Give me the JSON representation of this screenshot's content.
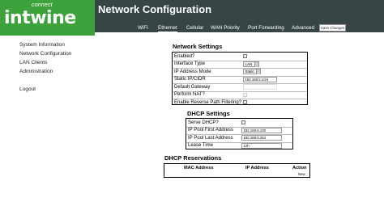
{
  "brand": {
    "tag": "connect",
    "name": "intwine",
    "color": "#3da23b"
  },
  "sidebar": {
    "items": [
      {
        "label": "System Information"
      },
      {
        "label": "Network Configuration"
      },
      {
        "label": "LAN Clients"
      },
      {
        "label": "Administration"
      },
      {
        "label": "Logout"
      }
    ]
  },
  "header": {
    "title": "Network Configuration",
    "background": "#374547",
    "tabs": [
      {
        "label": "WiFi"
      },
      {
        "label": "Ethernet",
        "active": true
      },
      {
        "label": "Cellular"
      },
      {
        "label": "WAN Priority"
      },
      {
        "label": "Port Forwarding"
      },
      {
        "label": "Advanced"
      }
    ],
    "save_label": "Save Changes"
  },
  "network_settings": {
    "title": "Network Settings",
    "rows": [
      {
        "label": "Enabled?",
        "control": "checkbox"
      },
      {
        "label": "Interface Type",
        "control": "select",
        "value": "LAN"
      },
      {
        "label": "IP Address Mode",
        "control": "select",
        "value": "Static"
      },
      {
        "label": "Static IP/CIDR",
        "control": "text",
        "value": "192.168.5.1/24"
      },
      {
        "label": "Default Gateway",
        "control": "text",
        "value": ""
      },
      {
        "label": "Perform NAT?",
        "control": "checkbox"
      },
      {
        "label": "Enable Reverse Path Filtering?",
        "control": "checkbox"
      }
    ]
  },
  "dhcp_settings": {
    "title": "DHCP Settings",
    "rows": [
      {
        "label": "Serve DHCP?",
        "control": "checkbox"
      },
      {
        "label": "IP Pool First Address",
        "control": "text",
        "value": "192.168.5.100"
      },
      {
        "label": "IP Pool Last Address",
        "control": "text",
        "value": "192.168.5.254"
      },
      {
        "label": "Lease Time",
        "control": "text",
        "value": "12h"
      }
    ]
  },
  "dhcp_reservations": {
    "title": "DHCP Reservations",
    "columns": [
      "MAC Address",
      "IP Address",
      "Action"
    ],
    "new_label": "New"
  }
}
